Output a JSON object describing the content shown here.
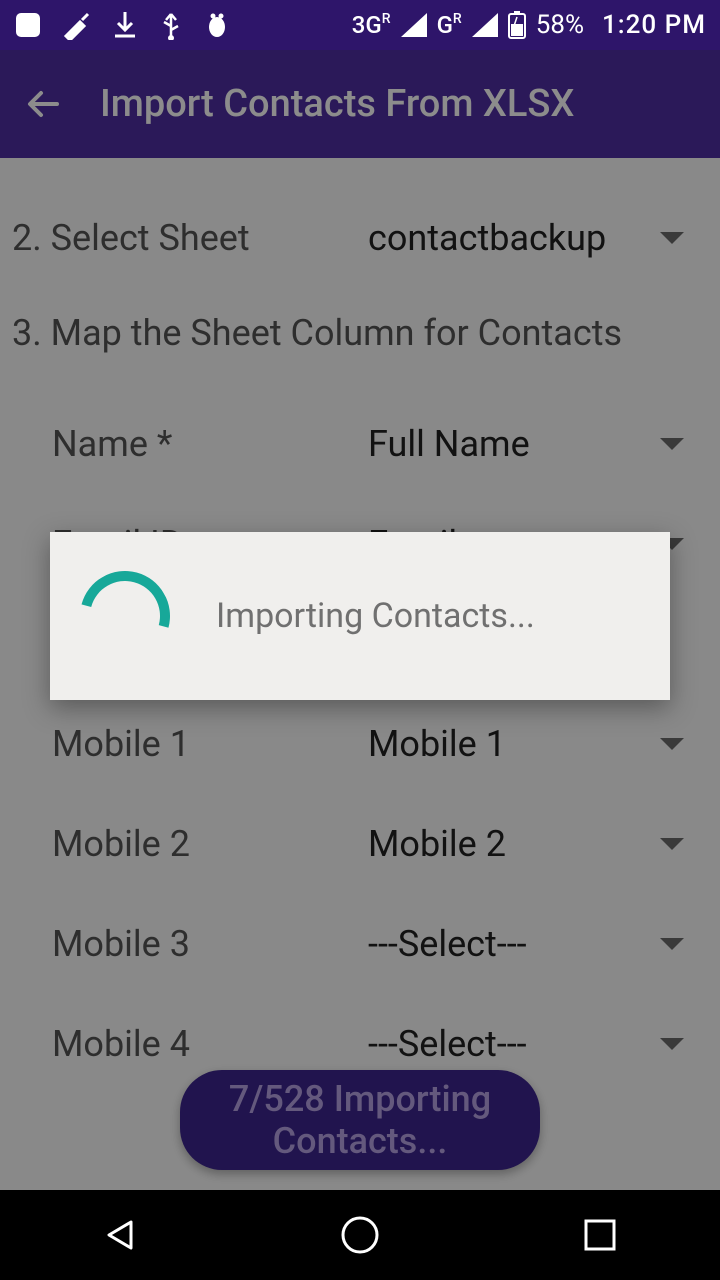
{
  "status": {
    "battery": "58%",
    "time": "1:20 PM",
    "network1": "3G",
    "network2": "G"
  },
  "appbar": {
    "title": "Import Contacts From XLSX"
  },
  "steps": {
    "step2_label": "2. Select Sheet",
    "step2_value": "contactbackup",
    "step3_label": "3. Map the Sheet Column for Contacts"
  },
  "mappings": [
    {
      "label": "Name *",
      "value": "Full Name"
    },
    {
      "label": "Email ID",
      "value": "Email"
    },
    {
      "label": "Mobile 1",
      "value": "Mobile 1"
    },
    {
      "label": "Mobile 2",
      "value": "Mobile 2"
    },
    {
      "label": "Mobile 3",
      "value": "---Select---"
    },
    {
      "label": "Mobile 4",
      "value": "---Select---"
    }
  ],
  "progress": {
    "button_text": "7/528 Importing Contacts...",
    "current": 7,
    "total": 528
  },
  "dialog": {
    "text": "Importing Contacts..."
  }
}
